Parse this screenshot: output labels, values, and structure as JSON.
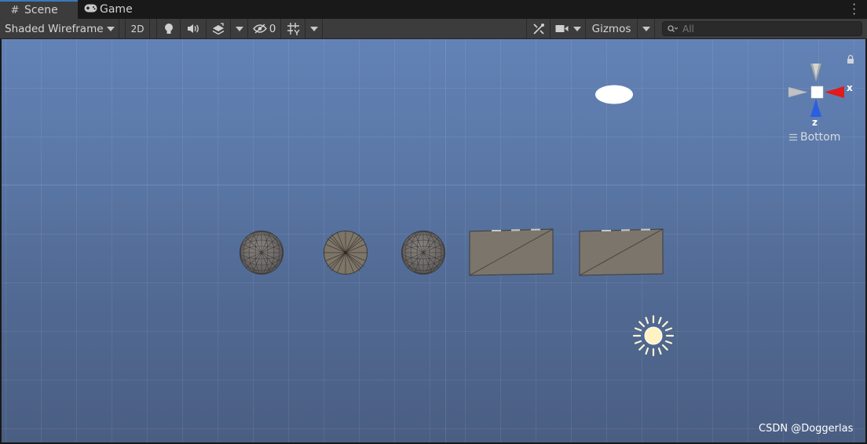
{
  "tabs": [
    {
      "label": "Scene",
      "icon": "grid-icon",
      "active": true
    },
    {
      "label": "Game",
      "icon": "gamepad-icon",
      "active": false
    }
  ],
  "toolbar": {
    "draw_mode": "Shaded Wireframe",
    "mode_2d": "2D",
    "hidden_count": "0",
    "gizmos": "Gizmos",
    "search_placeholder": "All"
  },
  "orientation_gizmo": {
    "x_label": "x",
    "z_label": "z",
    "view_label": "Bottom"
  },
  "scene_objects": [
    "sphere",
    "cylinder-disc",
    "sphere",
    "quad",
    "quad",
    "directional-light",
    "camera-ellipse"
  ],
  "watermark": "CSDN @Doggerlas",
  "colors": {
    "accent_tab": "#3a79bb",
    "toolbar_bg": "#3c3c3c",
    "scene_sky": "#5b78a7",
    "axis_x": "#e02020",
    "axis_z": "#2a63e0",
    "object_fill": "#7b756c"
  }
}
